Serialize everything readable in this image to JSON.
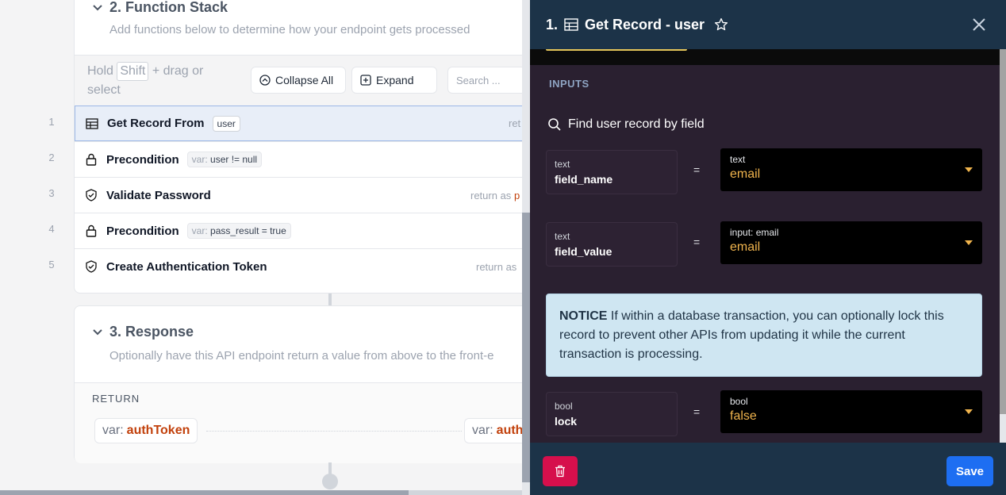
{
  "left": {
    "function_stack": {
      "title": "2. Function Stack",
      "subtitle": "Add functions below to determine how your endpoint gets processed",
      "toolbar": {
        "hold_prefix": "Hold",
        "hold_key": "Shift",
        "hold_suffix": "+ drag or select",
        "collapse_all": "Collapse All",
        "expand": "Expand",
        "search_placeholder": "Search ..."
      },
      "rows": [
        {
          "num": "1",
          "label": "Get Record From",
          "pill": "user",
          "right": "ret",
          "right_accent": ""
        },
        {
          "num": "2",
          "label": "Precondition",
          "pill_key": "var:",
          "pill_val": "user != null"
        },
        {
          "num": "3",
          "label": "Validate Password",
          "right": "return as",
          "right_accent": "p"
        },
        {
          "num": "4",
          "label": "Precondition",
          "pill_key": "var:",
          "pill_val": "pass_result = true"
        },
        {
          "num": "5",
          "label": "Create Authentication Token",
          "right": "return as",
          "right_accent": ""
        }
      ]
    },
    "response": {
      "title": "3. Response",
      "subtitle": "Optionally have this API endpoint return a value from above to the front-e",
      "return_label": "RETURN",
      "var1_key": "var:",
      "var1_val": "authToken",
      "var2_key": "var:",
      "var2_val": "auth"
    }
  },
  "panel": {
    "title_num": "1.",
    "title": "Get Record - user",
    "inputs_label": "INPUTS",
    "find_label": "Find user record by field",
    "params": [
      {
        "type": "text",
        "name": "field_name",
        "eq": "=",
        "value_type": "text",
        "value": "email"
      },
      {
        "type": "text",
        "name": "field_value",
        "eq": "=",
        "value_type": "input: email",
        "value": "email"
      },
      {
        "type": "bool",
        "name": "lock",
        "eq": "=",
        "value_type": "bool",
        "value": "false"
      }
    ],
    "notice": {
      "label": "NOTICE",
      "text": "If within a database transaction, you can optionally lock this record to prevent other APIs from updating it while the current transaction is processing."
    },
    "save": "Save"
  },
  "colors": {
    "panel_header": "#1c3348",
    "panel_body": "#2a2030",
    "accent_orange": "#c2410c",
    "value_yellow": "#f0b44d",
    "delete_red": "#d60f4c",
    "save_blue": "#1d6ef2"
  }
}
